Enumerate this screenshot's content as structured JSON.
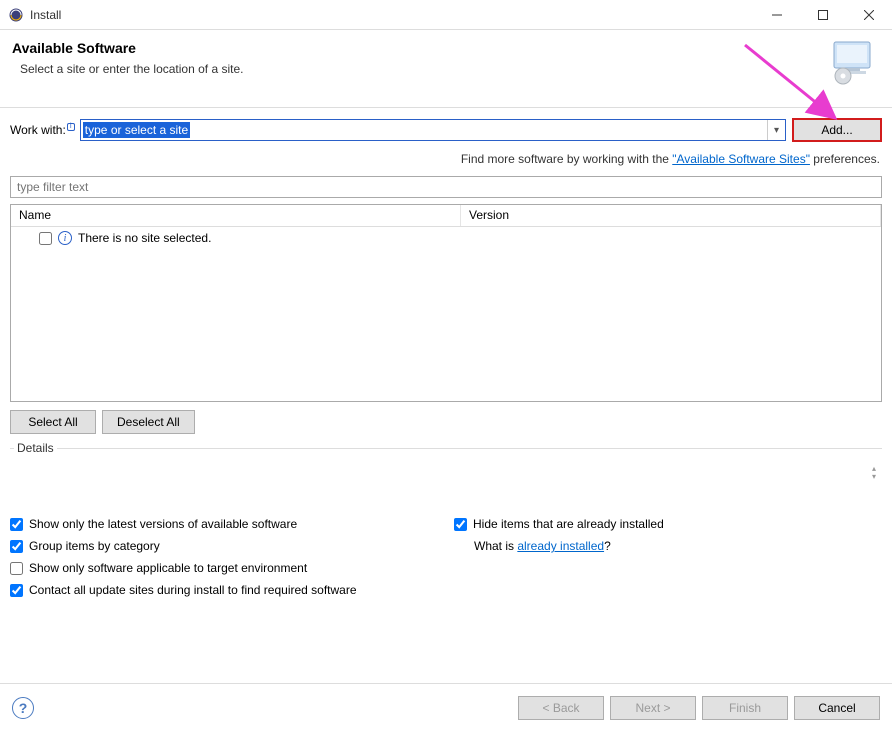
{
  "window": {
    "title": "Install"
  },
  "header": {
    "title": "Available Software",
    "subtitle": "Select a site or enter the location of a site."
  },
  "workwith": {
    "label": "Work with:",
    "placeholder": "type or select a site",
    "add_label": "Add..."
  },
  "hint": {
    "prefix": "Find more software by working with the ",
    "link": "\"Available Software Sites\"",
    "suffix": " preferences."
  },
  "filter": {
    "placeholder": "type filter text"
  },
  "tree": {
    "columns": {
      "name": "Name",
      "version": "Version"
    },
    "empty_message": "There is no site selected."
  },
  "buttons": {
    "select_all": "Select All",
    "deselect_all": "Deselect All"
  },
  "details": {
    "label": "Details"
  },
  "options": {
    "show_latest": "Show only the latest versions of available software",
    "group_category": "Group items by category",
    "show_applicable": "Show only software applicable to target environment",
    "contact_sites": "Contact all update sites during install to find required software",
    "hide_installed": "Hide items that are already installed",
    "whatis_prefix": "What is ",
    "whatis_link": "already installed",
    "whatis_suffix": "?"
  },
  "checked": {
    "show_latest": true,
    "group_category": true,
    "show_applicable": false,
    "contact_sites": true,
    "hide_installed": true
  },
  "footer": {
    "back": "< Back",
    "next": "Next >",
    "finish": "Finish",
    "cancel": "Cancel"
  }
}
